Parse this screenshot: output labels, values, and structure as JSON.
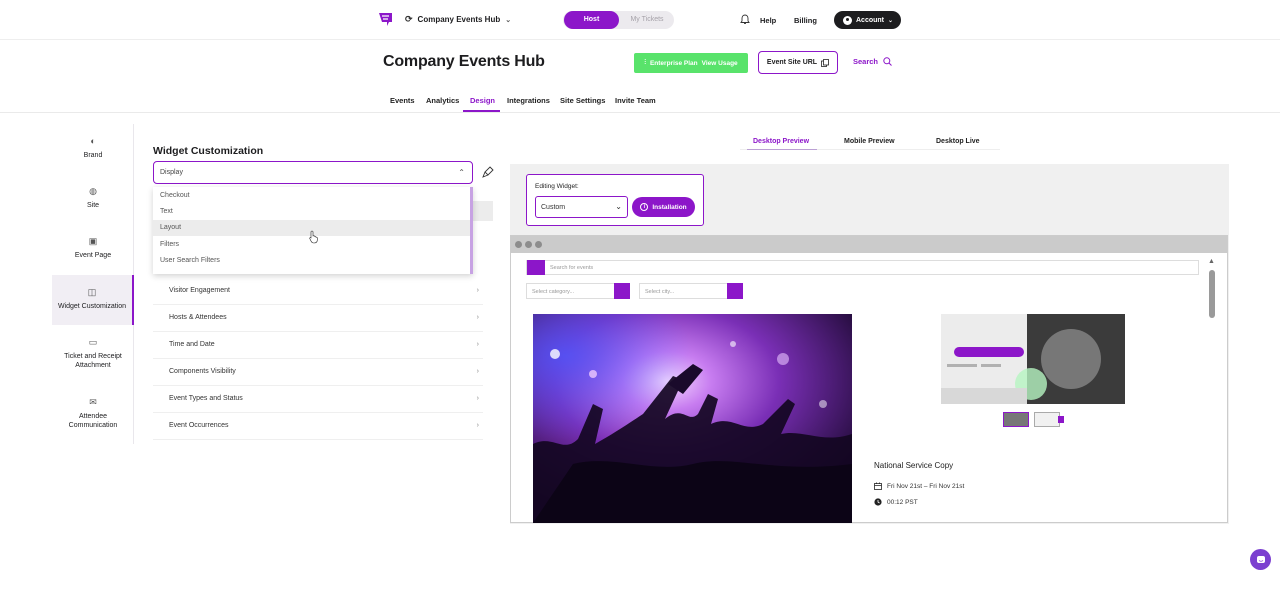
{
  "topbar": {
    "site_name": "Company Events Hub",
    "role_host": "Host",
    "role_tickets": "My Tickets",
    "help": "Help",
    "billing": "Billing",
    "account": "Account"
  },
  "header": {
    "title": "Company Events Hub",
    "plan_label": "Enterprise Plan",
    "view_usage": "View Usage",
    "event_site_url": "Event Site URL",
    "search": "Search"
  },
  "tabs": [
    {
      "label": "Events"
    },
    {
      "label": "Analytics"
    },
    {
      "label": "Design",
      "active": true
    },
    {
      "label": "Integrations"
    },
    {
      "label": "Site Settings"
    },
    {
      "label": "Invite Team"
    }
  ],
  "leftnav": {
    "items": [
      {
        "label": "Brand",
        "icon": "palette-icon"
      },
      {
        "label": "Site",
        "icon": "globe-icon"
      },
      {
        "label": "Event Page",
        "icon": "calendar-icon"
      },
      {
        "label": "Widget Customization",
        "icon": "widget-icon",
        "active": true
      },
      {
        "label": "Ticket and Receipt Attachment",
        "icon": "ticket-icon"
      },
      {
        "label": "Attendee Communication",
        "icon": "mail-icon"
      }
    ]
  },
  "widget": {
    "section_title": "Widget Customization",
    "selected": "Display",
    "options": [
      "Checkout",
      "Text",
      "Layout",
      "Filters",
      "User Search Filters"
    ],
    "hovered_option": "Layout",
    "list": [
      "Visitor Engagement",
      "Hosts & Attendees",
      "Time and Date",
      "Components Visibility",
      "Event Types and Status",
      "Event Occurrences"
    ]
  },
  "preview_tabs": [
    "Desktop Preview",
    "Mobile Preview",
    "Desktop Live"
  ],
  "editing": {
    "label": "Editing Widget:",
    "selected": "Custom",
    "install_button": "Installation"
  },
  "widget_preview": {
    "search_placeholder": "Search for events",
    "category_placeholder": "Select category...",
    "city_placeholder": "Select city...",
    "event_title": "National Service Copy",
    "date": "Fri Nov 21st – Fri Nov 21st",
    "time": "00:12 PST"
  },
  "colors": {
    "accent": "#8c16c9",
    "green": "#59e36b",
    "dark": "#1d1d1f"
  }
}
